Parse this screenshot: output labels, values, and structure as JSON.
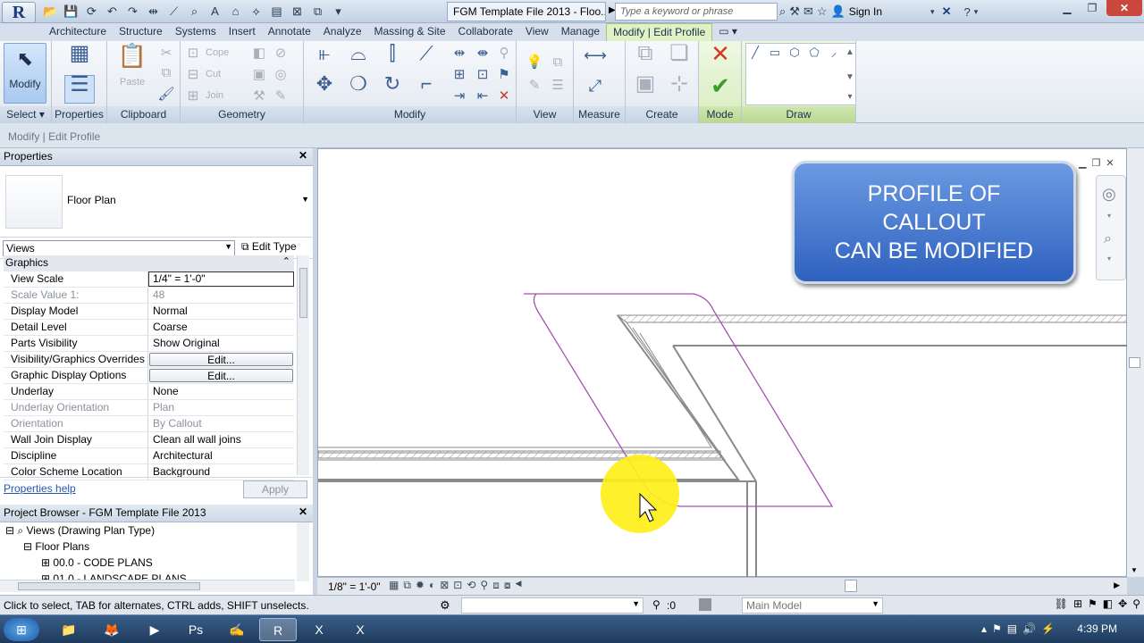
{
  "app": {
    "logo": "R",
    "doc_title": "FGM Template File 2013 - Floo...",
    "search_placeholder": "Type a keyword or phrase",
    "sign_in": "Sign In"
  },
  "tabs": [
    "Architecture",
    "Structure",
    "Systems",
    "Insert",
    "Annotate",
    "Analyze",
    "Massing & Site",
    "Collaborate",
    "View",
    "Manage",
    "Modify | Edit Profile"
  ],
  "active_tab": "Modify | Edit Profile",
  "ribbon": {
    "modify": {
      "label": "Modify",
      "panel": "Select ▾"
    },
    "properties": {
      "panel": "Properties"
    },
    "clipboard": {
      "panel": "Clipboard",
      "paste": "Paste"
    },
    "geometry": {
      "panel": "Geometry",
      "cope": "Cope",
      "cut": "Cut",
      "join": "Join"
    },
    "modify_panel": {
      "panel": "Modify"
    },
    "view": {
      "panel": "View"
    },
    "measure": {
      "panel": "Measure"
    },
    "create": {
      "panel": "Create"
    },
    "mode": {
      "panel": "Mode"
    },
    "draw": {
      "panel": "Draw"
    }
  },
  "options_bar": "Modify | Edit Profile",
  "properties_palette": {
    "title": "Properties",
    "type_name": "Floor Plan",
    "views_combo": "Views",
    "edit_type": "Edit Type",
    "group": "Graphics",
    "rows": [
      {
        "k": "View Scale",
        "v": "1/4\" = 1'-0\"",
        "kind": "input"
      },
      {
        "k": "Scale Value    1:",
        "v": "48",
        "kind": "ro"
      },
      {
        "k": "Display Model",
        "v": "Normal",
        "kind": "text"
      },
      {
        "k": "Detail Level",
        "v": "Coarse",
        "kind": "text"
      },
      {
        "k": "Parts Visibility",
        "v": "Show Original",
        "kind": "text"
      },
      {
        "k": "Visibility/Graphics Overrides",
        "v": "Edit...",
        "kind": "button"
      },
      {
        "k": "Graphic Display Options",
        "v": "Edit...",
        "kind": "button"
      },
      {
        "k": "Underlay",
        "v": "None",
        "kind": "text"
      },
      {
        "k": "Underlay Orientation",
        "v": "Plan",
        "kind": "ro"
      },
      {
        "k": "Orientation",
        "v": "By Callout",
        "kind": "ro"
      },
      {
        "k": "Wall Join Display",
        "v": "Clean all wall joins",
        "kind": "text"
      },
      {
        "k": "Discipline",
        "v": "Architectural",
        "kind": "text"
      },
      {
        "k": "Color Scheme Location",
        "v": "Background",
        "kind": "text"
      }
    ],
    "help": "Properties help",
    "apply": "Apply"
  },
  "project_browser": {
    "title": "Project Browser - FGM Template File 2013",
    "items": [
      "Views (Drawing Plan Type)",
      "Floor Plans",
      "00.0 - CODE PLANS",
      "01.0 - LANDSCAPE PLANS"
    ]
  },
  "callout_text": {
    "line1": "PROFILE OF",
    "line2": "CALLOUT",
    "line3": "CAN BE MODIFIED"
  },
  "view_control": {
    "scale": "1/8\" = 1'-0\""
  },
  "status": {
    "hint": "Click to select, TAB for alternates, CTRL adds, SHIFT unselects.",
    "sel_count": ":0",
    "model": "Main Model"
  },
  "taskbar": {
    "time": "4:39 PM"
  }
}
